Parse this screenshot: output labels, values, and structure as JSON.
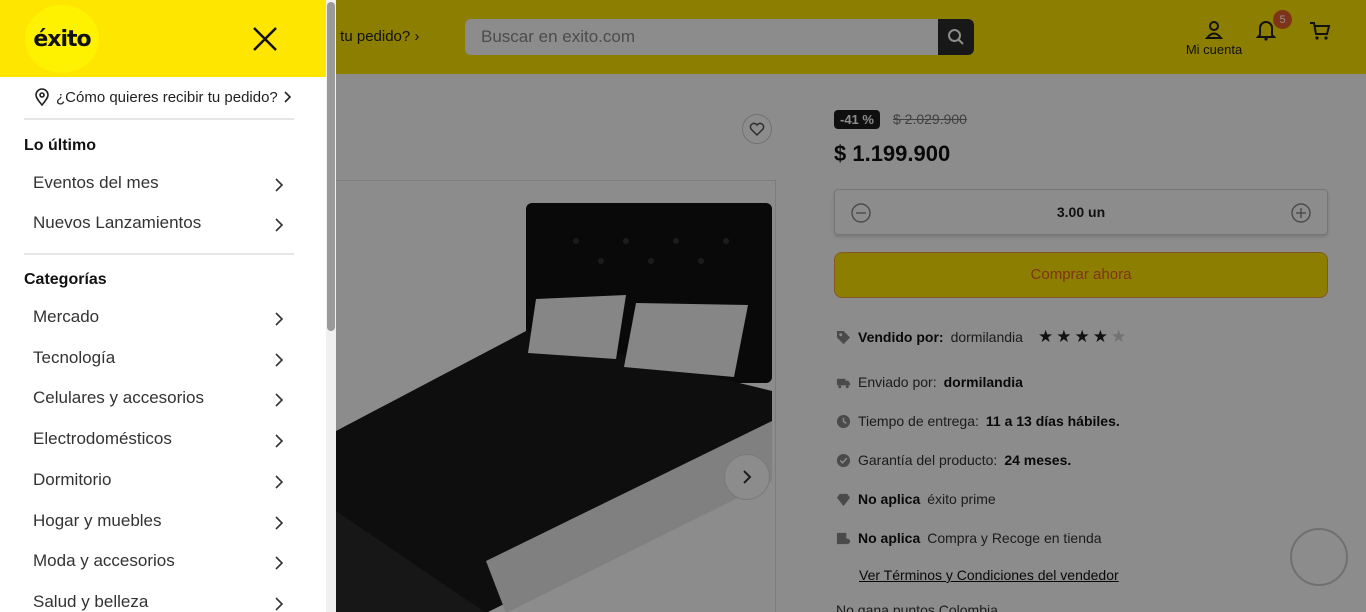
{
  "header": {
    "delivery_prompt": "ibir tu pedido?",
    "search_placeholder": "Buscar en exito.com",
    "account_label": "Mi cuenta",
    "notifications_count": "5"
  },
  "product": {
    "discount": "-41 %",
    "old_price": "$ 2.029.900",
    "price": "$ 1.199.900",
    "quantity": "3.00 un",
    "buy_label": "Comprar ahora",
    "rating": 4,
    "rating_max": 5,
    "sold_by_label": "Vendido por:",
    "sold_by": "dormilandia",
    "shipped_by_label": "Enviado por:",
    "shipped_by": "dormilandia",
    "delivery_time_label": "Tiempo de entrega:",
    "delivery_time": "11 a 13 días hábiles.",
    "warranty_label": "Garantía del producto:",
    "warranty": "24 meses.",
    "prime_label": "No aplica",
    "prime_text": "éxito prime",
    "pickup_label": "No aplica",
    "pickup_text": "Compra y Recoge en tienda",
    "terms_link": "Ver Términos y Condiciones del vendedor",
    "points_cut": "No gana puntos Colombia"
  },
  "drawer": {
    "logo": "éxito",
    "delivery_prompt": "¿Cómo quieres recibir tu pedido?",
    "sections": [
      {
        "title": "Lo último",
        "items": [
          "Eventos del mes",
          "Nuevos Lanzamientos"
        ]
      },
      {
        "title": "Categorías",
        "items": [
          "Mercado",
          "Tecnología",
          "Celulares y accesorios",
          "Electrodomésticos",
          "Dormitorio",
          "Hogar y muebles",
          "Moda y accesorios",
          "Salud y belleza"
        ]
      }
    ]
  },
  "colors": {
    "brand_yellow": "#ffe600",
    "accent_orange": "#e8602c",
    "overlay": "rgba(0,0,0,0.45)"
  }
}
